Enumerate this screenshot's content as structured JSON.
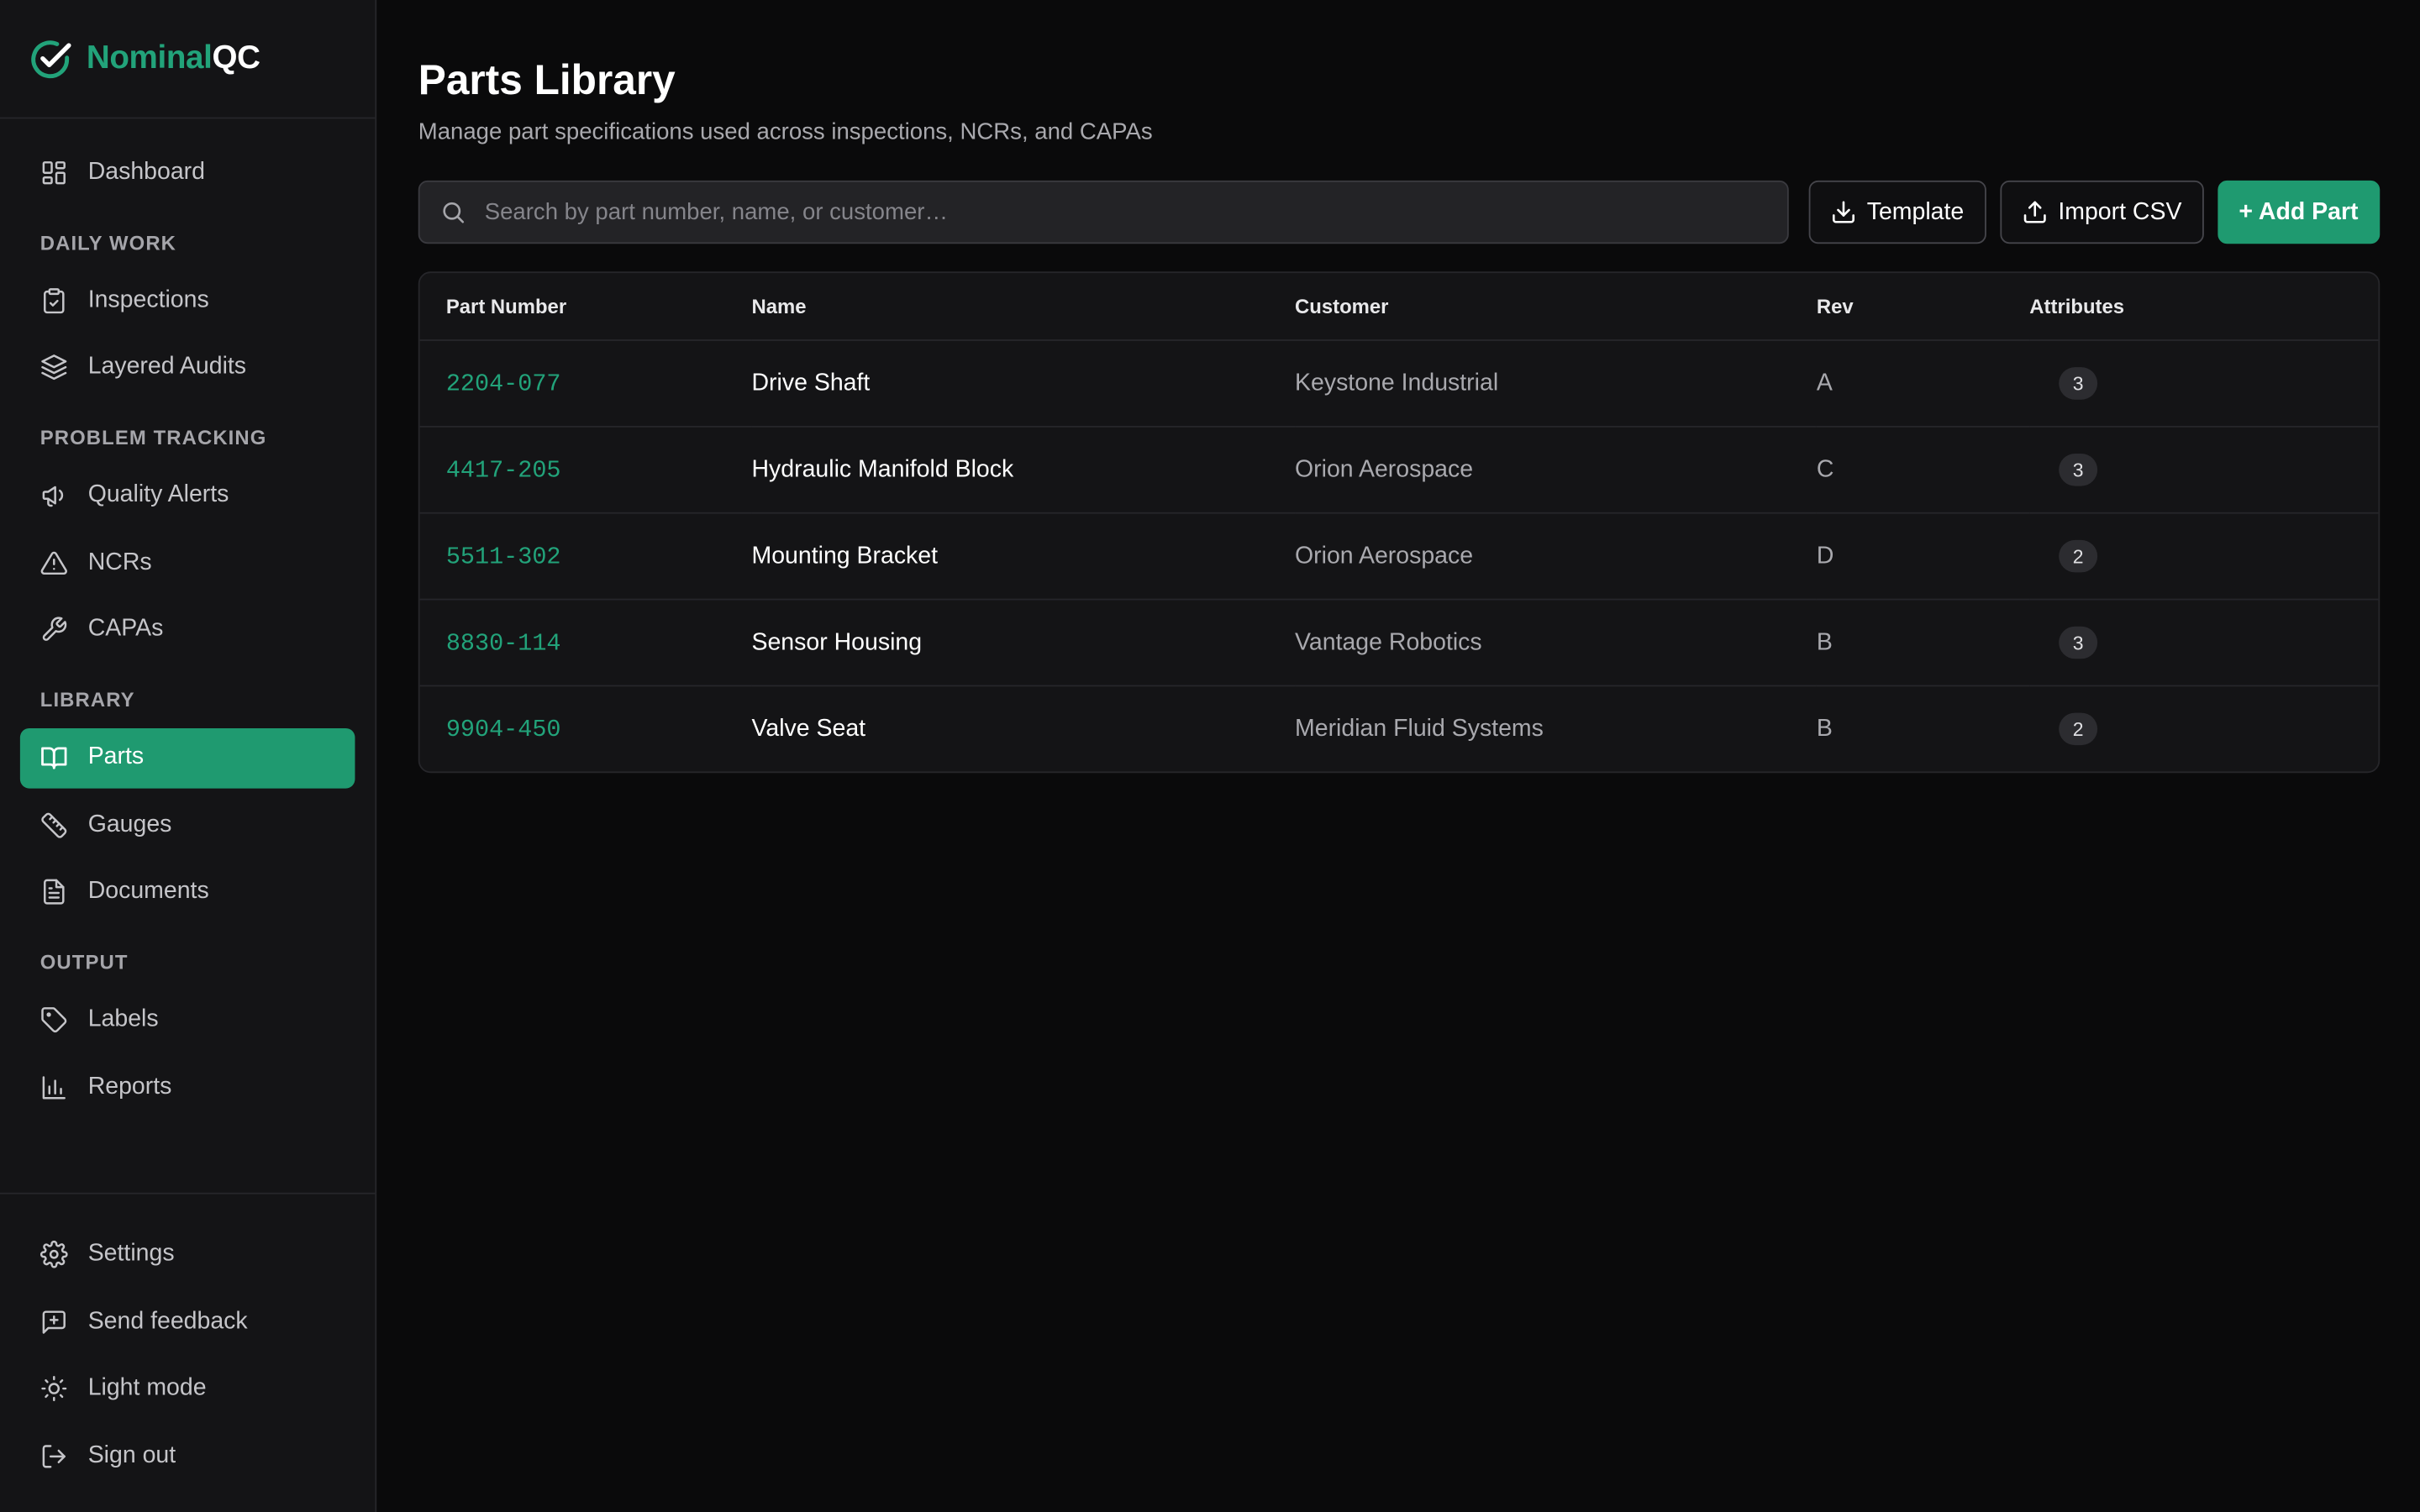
{
  "brand": {
    "part1": "Nominal",
    "part2": "QC"
  },
  "sidebar": {
    "dashboard": "Dashboard",
    "sections": {
      "daily_work": "DAILY WORK",
      "problem_tracking": "PROBLEM TRACKING",
      "library": "LIBRARY",
      "output": "OUTPUT"
    },
    "items": {
      "inspections": "Inspections",
      "layered_audits": "Layered Audits",
      "quality_alerts": "Quality Alerts",
      "ncrs": "NCRs",
      "capas": "CAPAs",
      "parts": "Parts",
      "gauges": "Gauges",
      "documents": "Documents",
      "labels": "Labels",
      "reports": "Reports"
    },
    "bottom": {
      "settings": "Settings",
      "send_feedback": "Send feedback",
      "light_mode": "Light mode",
      "sign_out": "Sign out"
    }
  },
  "page": {
    "title": "Parts Library",
    "subtitle": "Manage part specifications used across inspections, NCRs, and CAPAs"
  },
  "toolbar": {
    "search_placeholder": "Search by part number, name, or customer…",
    "template_label": "Template",
    "import_label": "Import CSV",
    "add_label": "+ Add Part"
  },
  "table": {
    "headers": {
      "part_number": "Part Number",
      "name": "Name",
      "customer": "Customer",
      "rev": "Rev",
      "attributes": "Attributes"
    },
    "rows": [
      {
        "part_number": "2204-077",
        "name": "Drive Shaft",
        "customer": "Keystone Industrial",
        "rev": "A",
        "attributes": "3"
      },
      {
        "part_number": "4417-205",
        "name": "Hydraulic Manifold Block",
        "customer": "Orion Aerospace",
        "rev": "C",
        "attributes": "3"
      },
      {
        "part_number": "5511-302",
        "name": "Mounting Bracket",
        "customer": "Orion Aerospace",
        "rev": "D",
        "attributes": "2"
      },
      {
        "part_number": "8830-114",
        "name": "Sensor Housing",
        "customer": "Vantage Robotics",
        "rev": "B",
        "attributes": "3"
      },
      {
        "part_number": "9904-450",
        "name": "Valve Seat",
        "customer": "Meridian Fluid Systems",
        "rev": "B",
        "attributes": "2"
      }
    ]
  },
  "colors": {
    "accent": "#1f9a70",
    "brand_green": "#22a37a",
    "background": "#0a0a0b",
    "sidebar": "#141416"
  },
  "icons": {
    "brand": "check-circle-icon",
    "dashboard": "dashboard-grid-icon",
    "inspections": "clipboard-check-icon",
    "layered_audits": "layers-icon",
    "quality_alerts": "megaphone-icon",
    "ncrs": "warning-triangle-icon",
    "capas": "wrench-icon",
    "parts": "book-open-icon",
    "gauges": "ruler-icon",
    "documents": "document-icon",
    "labels": "tag-icon",
    "reports": "bar-chart-icon",
    "settings": "gear-icon",
    "send_feedback": "message-plus-icon",
    "light_mode": "sun-icon",
    "sign_out": "sign-out-icon",
    "search": "search-icon",
    "template": "download-icon",
    "import": "upload-icon"
  }
}
